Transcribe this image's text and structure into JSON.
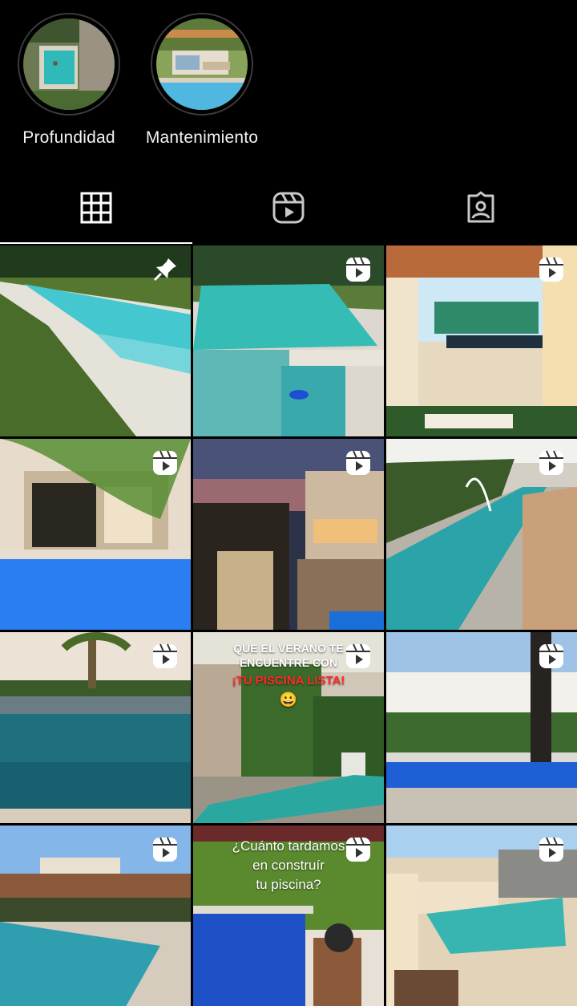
{
  "highlights": [
    {
      "label": "Profundidad"
    },
    {
      "label": "Mantenimiento"
    }
  ],
  "tabs": [
    {
      "name": "grid-icon",
      "active": true
    },
    {
      "name": "reels-icon",
      "active": false
    },
    {
      "name": "tagged-icon",
      "active": false
    }
  ],
  "posts": [
    {
      "badge": "pin-icon"
    },
    {
      "badge": "reel-icon"
    },
    {
      "badge": "reel-icon"
    },
    {
      "badge": "reel-icon"
    },
    {
      "badge": "reel-icon"
    },
    {
      "badge": "reel-icon"
    },
    {
      "badge": "reel-icon"
    },
    {
      "badge": "reel-icon",
      "text_top": "QUE EL VERANO TE",
      "text_mid": "ENCUENTRE CON",
      "text_red": "¡TU PISCINA LISTA!",
      "emoji": "😀"
    },
    {
      "badge": "reel-icon"
    },
    {
      "badge": "reel-icon"
    },
    {
      "badge": "reel-icon",
      "text_top": "¿Cuánto tardamos",
      "text_mid": "en construír",
      "text_bottom": "tu piscina?"
    },
    {
      "badge": "reel-icon"
    }
  ],
  "colors": {
    "background": "#000000",
    "pool": "#3fc1c9",
    "pin": "#ffffff"
  }
}
